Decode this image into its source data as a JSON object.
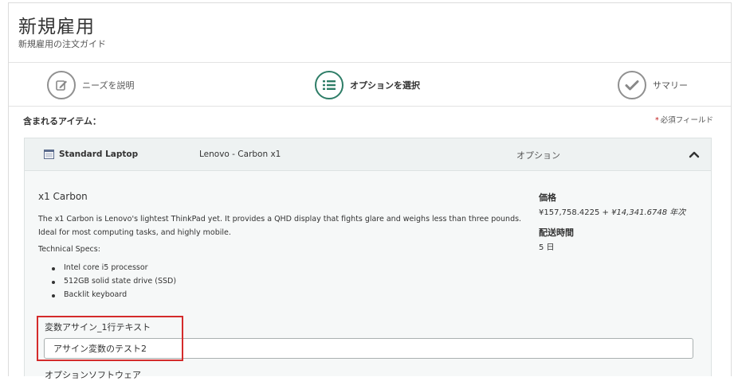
{
  "header": {
    "title": "新規雇用",
    "subtitle": "新規雇用の注文ガイド"
  },
  "steps": [
    {
      "label": "ニーズを説明",
      "icon": "edit-icon",
      "active": false
    },
    {
      "label": "オプションを選択",
      "icon": "list-icon",
      "active": true
    },
    {
      "label": "サマリー",
      "icon": "checkmark-icon",
      "active": false
    }
  ],
  "content": {
    "included_items_label": "含まれるアイテム：",
    "required_mark": "*",
    "required_label": "必須フィールド"
  },
  "item": {
    "name": "Standard Laptop",
    "model": "Lenovo - Carbon x1",
    "option_label": "オプション",
    "product_title": "x1 Carbon",
    "description": "The x1 Carbon is Lenovo's lightest ThinkPad yet. It provides a QHD display that fights glare and weighs less than three pounds. Ideal for most computing tasks, and highly mobile.",
    "specs_heading": "Technical Specs:",
    "specs": [
      "Intel core i5 processor",
      "512GB solid state drive (SSD)",
      "Backlit keyboard"
    ],
    "price_heading": "価格",
    "price": "¥157,758.4225",
    "price_recurring": " + ¥14,341.6748 年次",
    "delivery_heading": "配送時間",
    "delivery": "5 日"
  },
  "variables": {
    "single_line_label": "変数アサイン_1行テキスト",
    "single_line_value": "アサイン変数のテスト2",
    "next_label": "オプションソフトウェア"
  },
  "colors": {
    "accent": "#2e7d67",
    "highlight": "#d42b2b",
    "required": "#c02020"
  }
}
